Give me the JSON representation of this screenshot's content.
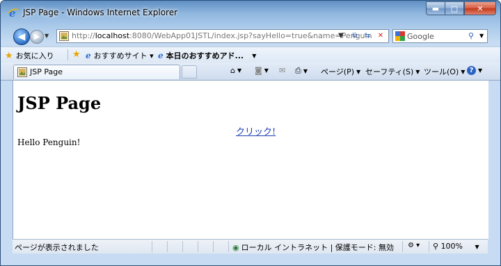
{
  "window": {
    "title": "JSP Page - Windows Internet Explorer"
  },
  "nav": {
    "address": "http://localhost:8080/WebApp01JSTL/index.jsp?sayHello=true&name=Penguin",
    "address_host_prefix": "http://",
    "address_host": "localhost",
    "address_rest": ":8080/WebApp01JSTL/index.jsp?sayHello=true&name=Penguin",
    "search_placeholder": "Google"
  },
  "favorites": {
    "favorites_label": "お気に入り",
    "items": [
      "おすすめサイト ▾",
      "本日のおすすめアド..."
    ]
  },
  "tab": {
    "label": "JSP Page"
  },
  "toolbar": {
    "page_label": "ページ(P)",
    "safety_label": "セーフティ(S)",
    "tools_label": "ツール(O)"
  },
  "content": {
    "heading": "JSP Page",
    "link_text": "クリック!",
    "message": "Hello Penguin!"
  },
  "status": {
    "text": "ページが表示されました",
    "zone": "ローカル イントラネット | 保護モード: 無効",
    "zoom": "100%"
  },
  "colors": {
    "link": "#1a3fb0",
    "frame": "#8fb6de"
  }
}
